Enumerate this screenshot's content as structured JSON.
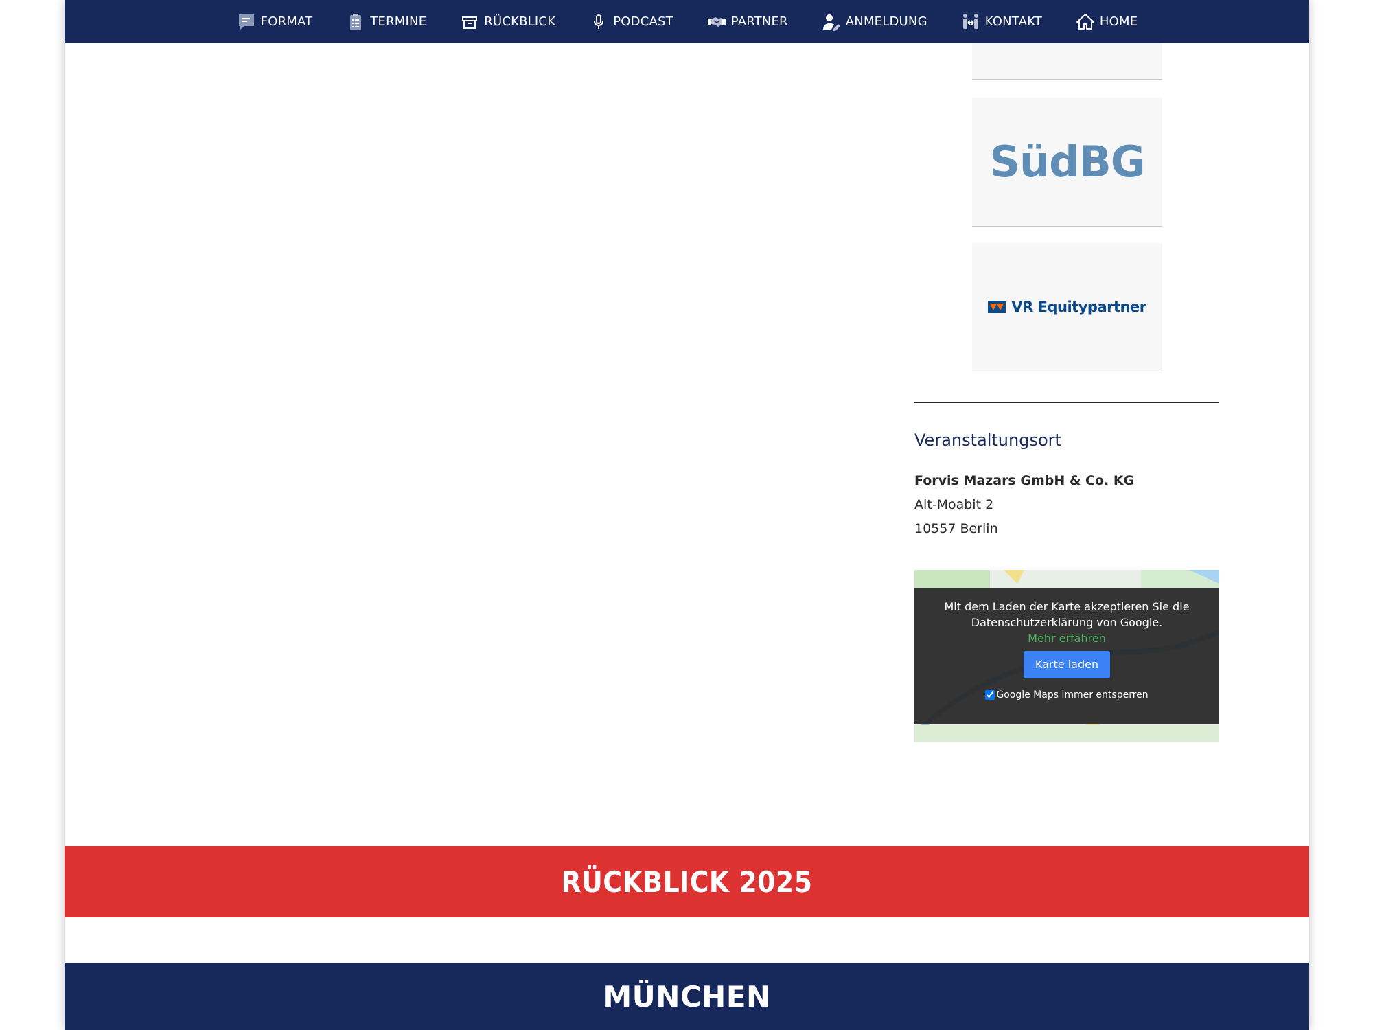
{
  "nav": {
    "items": [
      {
        "label": "FORMAT",
        "icon": "chat-bubble-icon"
      },
      {
        "label": "TERMINE",
        "icon": "clipboard-list-icon"
      },
      {
        "label": "RÜCKBLICK",
        "icon": "archive-box-icon"
      },
      {
        "label": "PODCAST",
        "icon": "microphone-icon"
      },
      {
        "label": "PARTNER",
        "icon": "handshake-icon"
      },
      {
        "label": "ANMELDUNG",
        "icon": "user-edit-icon"
      },
      {
        "label": "KONTAKT",
        "icon": "people-arrows-icon"
      },
      {
        "label": "HOME",
        "icon": "home-icon"
      }
    ]
  },
  "sponsors": {
    "sudbg": "SüdBG",
    "vr": "VR Equitypartner"
  },
  "venue": {
    "heading": "Veranstaltungsort",
    "name": "Forvis Mazars GmbH & Co. KG",
    "street": "Alt-Moabit 2",
    "city": "10557 Berlin"
  },
  "map": {
    "notice": "Mit dem Laden der Karte akzeptieren Sie die Datenschutzerklärung von Google.",
    "more_link": "Mehr erfahren",
    "load_button": "Karte laden",
    "always_unlock_label": "Google Maps immer entsperren",
    "always_unlock_checked": true
  },
  "bands": {
    "red_title": "RÜCKBLICK 2025",
    "navy_title": "MÜNCHEN"
  },
  "colors": {
    "navy": "#17285a",
    "red": "#dc3232",
    "button_blue": "#3b82f6",
    "link_green": "#4fb35f",
    "sudbg_blue": "#5f8db5",
    "vr_blue": "#0a4a8c"
  }
}
